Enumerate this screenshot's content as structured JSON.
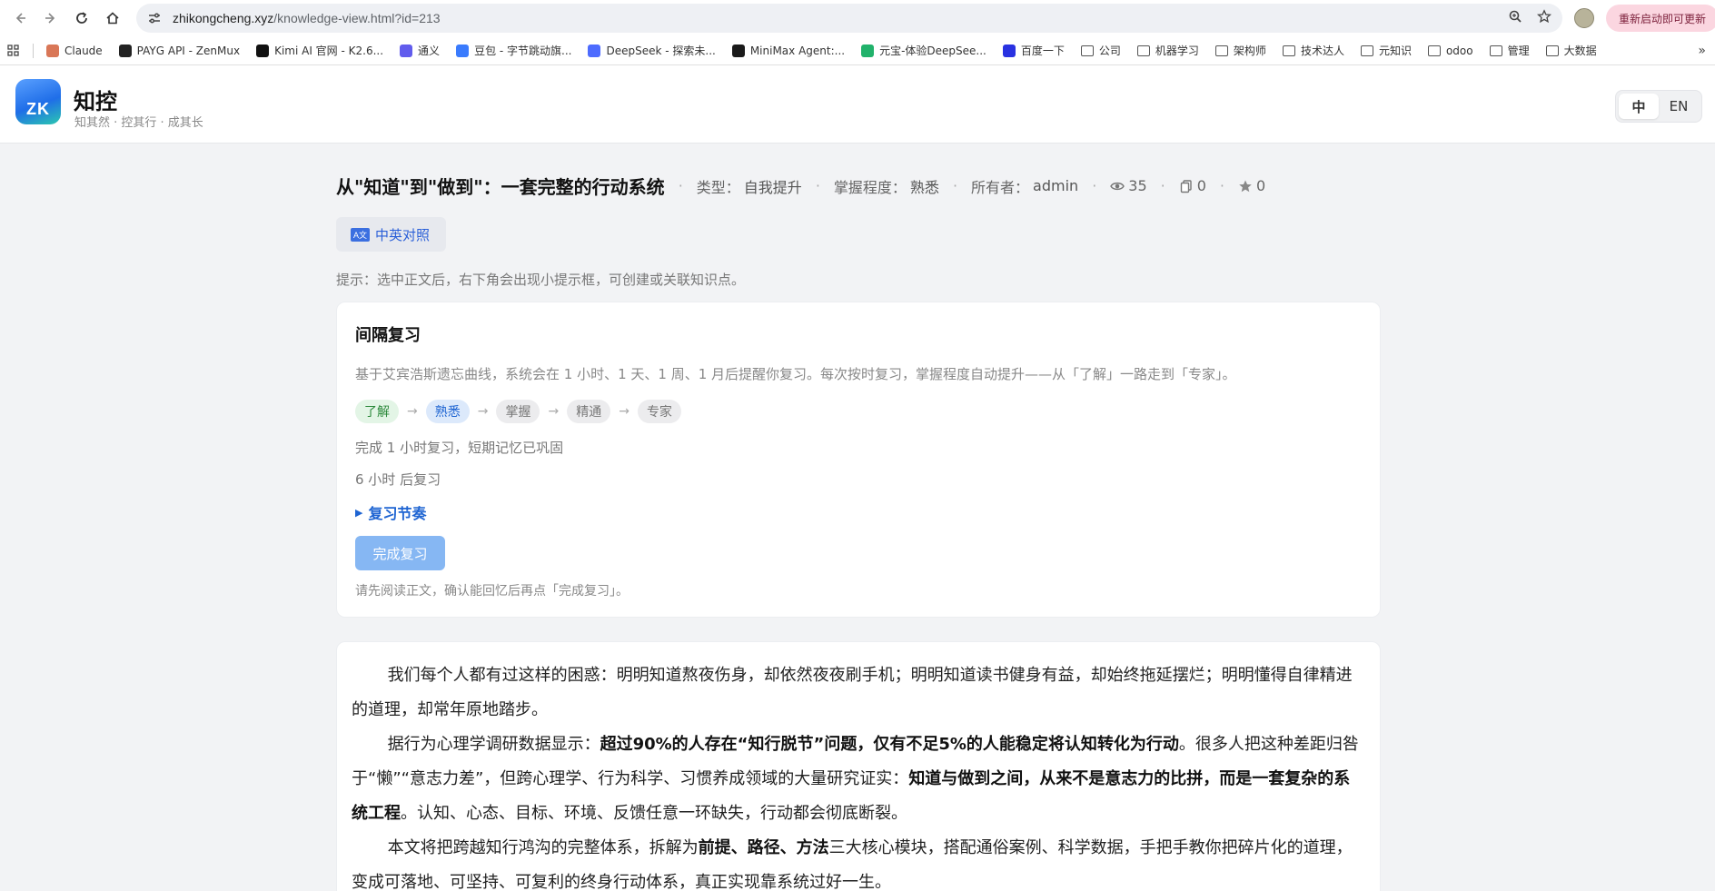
{
  "browser": {
    "url_host": "zhikongcheng.xyz",
    "url_path": "/knowledge-view.html?id=213",
    "restart_label": "重新启动即可更新"
  },
  "bookmarks": [
    {
      "label": "Claude",
      "icon": "claude-icon",
      "color": "#d97757"
    },
    {
      "label": "PAYG API - ZenMux",
      "icon": "zenmux-icon",
      "color": "#222222"
    },
    {
      "label": "Kimi AI 官网 - K2.6...",
      "icon": "kimi-icon",
      "color": "#111111"
    },
    {
      "label": "通义",
      "icon": "tongyi-icon",
      "color": "#615ced"
    },
    {
      "label": "豆包 - 字节跳动旗...",
      "icon": "doubao-icon",
      "color": "#3a7bfd"
    },
    {
      "label": "DeepSeek - 探索未...",
      "icon": "deepseek-icon",
      "color": "#4d6bfe"
    },
    {
      "label": "MiniMax Agent:...",
      "icon": "minimax-icon",
      "color": "#1a1a1a"
    },
    {
      "label": "元宝-体验DeepSee...",
      "icon": "yuanbao-icon",
      "color": "#21b26b"
    },
    {
      "label": "百度一下",
      "icon": "baidu-icon",
      "color": "#2932e1"
    },
    {
      "label": "公司",
      "icon": "folder-icon"
    },
    {
      "label": "机器学习",
      "icon": "folder-icon"
    },
    {
      "label": "架构师",
      "icon": "folder-icon"
    },
    {
      "label": "技术达人",
      "icon": "folder-icon"
    },
    {
      "label": "元知识",
      "icon": "folder-icon"
    },
    {
      "label": "odoo",
      "icon": "folder-icon"
    },
    {
      "label": "管理",
      "icon": "folder-icon"
    },
    {
      "label": "大数据",
      "icon": "folder-icon"
    }
  ],
  "header": {
    "logo_text": "ZK",
    "title": "知控",
    "subtitle": "知其然 · 控其行 · 成其长",
    "lang_zh": "中",
    "lang_en": "EN"
  },
  "article": {
    "title": "从\"知道\"到\"做到\"：一套完整的行动系统",
    "type_label": "类型：",
    "type_value": "自我提升",
    "mastery_label": "掌握程度：",
    "mastery_value": "熟悉",
    "owner_label": "所有者：",
    "owner_value": "admin",
    "views": "35",
    "copies": "0",
    "stars": "0",
    "compare_label": "中英对照",
    "hint": "提示：选中正文后，右下角会出现小提示框，可创建或关联知识点。"
  },
  "review": {
    "title": "间隔复习",
    "desc": "基于艾宾浩斯遗忘曲线，系统会在 1 小时、1 天、1 周、1 月后提醒你复习。每次按时复习，掌握程度自动提升——从「了解」一路走到「专家」。",
    "levels": [
      "了解",
      "熟悉",
      "掌握",
      "精通",
      "专家"
    ],
    "status": "完成 1 小时复习，短期记忆已巩固",
    "next": "6 小时 后复习",
    "rhythm_label": "复习节奏",
    "complete_label": "完成复习",
    "note": "请先阅读正文，确认能回忆后再点「完成复习」。"
  },
  "body": {
    "p1": "我们每个人都有过这样的困惑：明明知道熬夜伤身，却依然夜夜刷手机；明明知道读书健身有益，却始终拖延摆烂；明明懂得自律精进的道理，却常年原地踏步。",
    "p2_a": "据行为心理学调研数据显示：",
    "p2_b": "超过90%的人存在“知行脱节”问题，仅有不足5%的人能稳定将认知转化为行动",
    "p2_c": "。很多人把这种差距归咎于“懒”“意志力差”，但跨心理学、行为科学、习惯养成领域的大量研究证实：",
    "p2_d": "知道与做到之间，从来不是意志力的比拼，而是一套复杂的系统工程",
    "p2_e": "。认知、心态、目标、环境、反馈任意一环缺失，行动都会彻底断裂。",
    "p3_a": "本文将把跨越知行鸿沟的完整体系，拆解为",
    "p3_b": "前提、路径、方法",
    "p3_c": "三大核心模块，搭配通俗案例、科学数据，手把手教你把碎片化的道理，变成可落地、可坚持、可复利的终身行动体系，真正实现靠系统过好一生。"
  }
}
